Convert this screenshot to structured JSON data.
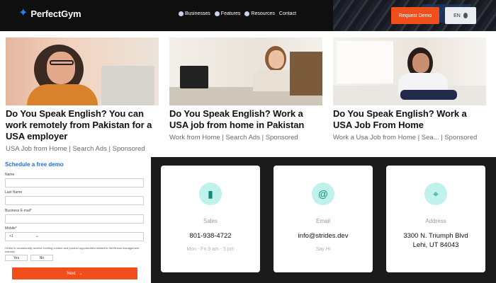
{
  "header": {
    "logo_text": "PerfectGym",
    "nav": [
      {
        "label": "Businesses"
      },
      {
        "label": "Features"
      },
      {
        "label": "Resources"
      },
      {
        "label": "Contact"
      }
    ],
    "request_demo_label": "Request Demo",
    "language_label": "EN"
  },
  "ads": [
    {
      "title": "Do You Speak English? You can work remotely from Pakistan for a USA employer",
      "meta": "USA Job from Home | Search Ads | Sponsored"
    },
    {
      "title": "Do You Speak English? Work a USA job from home in Pakistan",
      "meta": "Work from Home | Search Ads | Sponsored"
    },
    {
      "title": "Do You Speak English? Work a USA Job From Home",
      "meta": "Work a Usa Job from Home | Sea... | Sponsored"
    }
  ],
  "form": {
    "title": "Schedule a free demo",
    "fields": {
      "name_label": "Name",
      "last_name_label": "Last Name",
      "email_label": "Business E-mail*",
      "mobile_label": "Mobile*",
      "mobile_prefix": "+1"
    },
    "consent_text": "I'd like to occasionally receive exciting content and product opportunities related to the fitness management industry",
    "yes_label": "Yes",
    "no_label": "No",
    "next_label": "Next"
  },
  "contact": {
    "cards": [
      {
        "label": "Sales",
        "value": "801-938-4722",
        "note": "Mon - Fri 9 am - 5 pm",
        "icon": "phone-icon"
      },
      {
        "label": "Email",
        "value": "info@strides.dev",
        "note": "Say Hi",
        "icon": "at-icon"
      },
      {
        "label": "Address",
        "value": "3300 N. Triumph Blvd\nLehi, UT 84043",
        "note": "",
        "icon": "map-pin-icon"
      }
    ]
  }
}
